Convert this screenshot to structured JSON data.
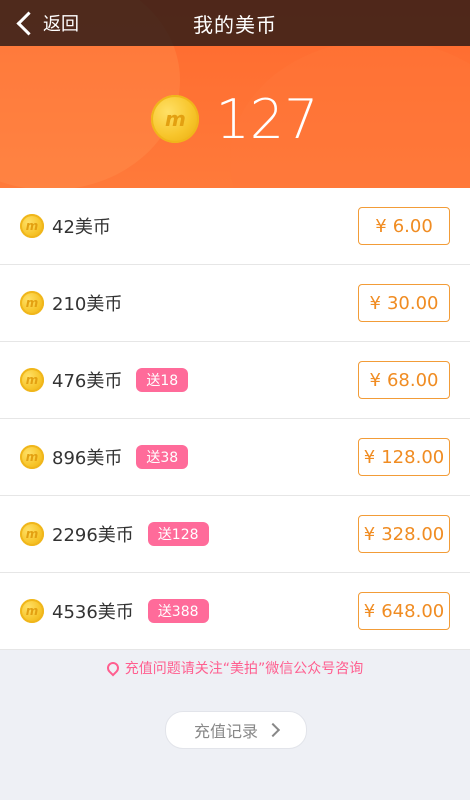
{
  "nav": {
    "back_label": "返回",
    "title": "我的美币"
  },
  "balance": {
    "coin_icon": "m",
    "amount": "127"
  },
  "packages": [
    {
      "coin_icon": "m",
      "label": "42美币",
      "bonus": "",
      "currency": "¥",
      "price": "6.00"
    },
    {
      "coin_icon": "m",
      "label": "210美币",
      "bonus": "",
      "currency": "¥",
      "price": "30.00"
    },
    {
      "coin_icon": "m",
      "label": "476美币",
      "bonus": "送18",
      "currency": "¥",
      "price": "68.00"
    },
    {
      "coin_icon": "m",
      "label": "896美币",
      "bonus": "送38",
      "currency": "¥",
      "price": "128.00"
    },
    {
      "coin_icon": "m",
      "label": "2296美币",
      "bonus": "送128",
      "currency": "¥",
      "price": "328.00"
    },
    {
      "coin_icon": "m",
      "label": "4536美币",
      "bonus": "送388",
      "currency": "¥",
      "price": "648.00"
    }
  ],
  "notice": "充值问题请关注“美拍”微信公众号咨询",
  "history_button": "充值记录",
  "colors": {
    "accent": "#ff6a2e",
    "price": "#f08c22",
    "bonus": "#ff6b9a"
  }
}
